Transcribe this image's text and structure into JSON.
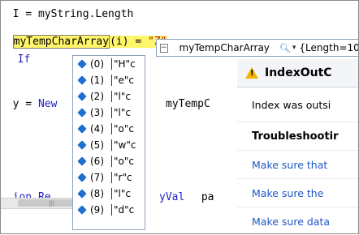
{
  "code": {
    "line1": "I = myString.Length",
    "line2_var": "myTempCharArray",
    "line2_rest": "(i) = ",
    "line2_str": "\"Z\"",
    "line3_kw": "If",
    "line4_prefix": "y = ",
    "line4_kw": "New",
    "line4_rest": "myTempC",
    "line6_prefix": "ion Re",
    "line6_kw": "yVal",
    "line6_rest": " pa"
  },
  "datatip": {
    "expand_glyph": "−",
    "variable": "myTempCharArray",
    "dropdown_glyph": "▾",
    "value": "{Length=10}",
    "items": [
      {
        "index": "(0)",
        "value": "\"H\"c"
      },
      {
        "index": "(1)",
        "value": "\"e\"c"
      },
      {
        "index": "(2)",
        "value": "\"l\"c"
      },
      {
        "index": "(3)",
        "value": "\"l\"c"
      },
      {
        "index": "(4)",
        "value": "\"o\"c"
      },
      {
        "index": "(5)",
        "value": "\"w\"c"
      },
      {
        "index": "(6)",
        "value": "\"o\"c"
      },
      {
        "index": "(7)",
        "value": "\"r\"c"
      },
      {
        "index": "(8)",
        "value": "\"l\"c"
      },
      {
        "index": "(9)",
        "value": "\"d\"c"
      }
    ]
  },
  "exception": {
    "title": "IndexOutC",
    "message": "Index was outsi",
    "troubleshooting": "Troubleshootir",
    "links": [
      "Make sure that",
      "Make sure the",
      "Make sure data"
    ]
  },
  "colors": {
    "keyword": "#1f1fc4",
    "string": "#a31515",
    "highlight": "#fff56b",
    "link": "#1f57c3",
    "warning": "#f0b400"
  }
}
